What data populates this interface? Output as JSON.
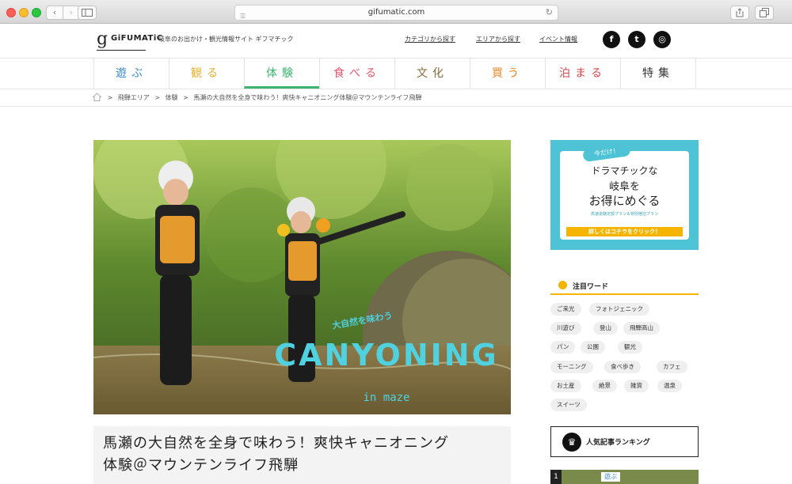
{
  "browser": {
    "url": "gifumatic.com",
    "back_icon": "chevron-left-icon",
    "forward_icon": "chevron-right-icon"
  },
  "header": {
    "logo_mark": "g",
    "logo_text": "GiFUMATiC",
    "tagline": "岐阜のお出かけ・観光情報サイト ギフマチック",
    "links": [
      "カテゴリから探す",
      "エリアから探す",
      "イベント情報"
    ],
    "social": [
      {
        "name": "facebook-icon",
        "glyph": "f"
      },
      {
        "name": "twitter-icon",
        "glyph": "t"
      },
      {
        "name": "instagram-icon",
        "glyph": "◎"
      }
    ]
  },
  "categories": [
    {
      "label": "遊ぶ",
      "color": "#3a8ad6"
    },
    {
      "label": "観る",
      "color": "#e7b12a"
    },
    {
      "label": "体験",
      "color": "#3cb371",
      "active": true
    },
    {
      "label": "食べる",
      "color": "#e8566c"
    },
    {
      "label": "文化",
      "color": "#8a6a3a"
    },
    {
      "label": "買う",
      "color": "#e5892a"
    },
    {
      "label": "泊まる",
      "color": "#d9464a"
    },
    {
      "label": "特集",
      "color": "#333333"
    }
  ],
  "breadcrumb": {
    "items": [
      "飛騨エリア",
      "体験",
      "馬瀬の大自然を全身で味わう！爽快キャニオニング体験＠マウンテンライフ飛騨"
    ],
    "separator": ">"
  },
  "hero": {
    "overlay_sub": "大自然を味わう",
    "overlay_main": "CANYONING",
    "overlay_tail": "in maze"
  },
  "article": {
    "title_line1": "馬瀬の大自然を全身で味わう！爽快キャニオニング",
    "title_line2": "体験＠マウンテンライフ飛騨"
  },
  "sidebar": {
    "ad": {
      "badge": "今だけ！",
      "line1": "ドラマチックな",
      "line2": "岐阜を",
      "line3": "お得にめぐる",
      "small": "高速道路定額プラン＆特別宿泊プラン",
      "button": "詳しくはコチラをクリック！"
    },
    "keywords_title": "注目ワード",
    "keywords": [
      "ご来光",
      "フォトジェニック",
      "川遊び",
      "登山",
      "飛騨高山",
      "パン",
      "公園",
      "観光",
      "モーニング",
      "食べ歩き",
      "カフェ",
      "お土産",
      "絶景",
      "雑貨",
      "温泉",
      "スイーツ"
    ],
    "ranking_title": "人気記事ランキング",
    "ranking_first": {
      "num": "1",
      "category": "遊ぶ"
    }
  }
}
